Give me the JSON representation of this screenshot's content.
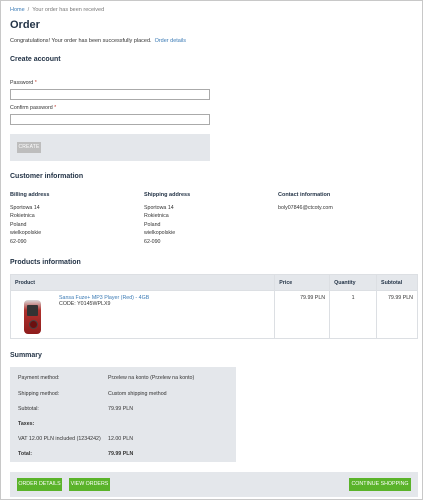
{
  "breadcrumb": {
    "home": "Home",
    "separator": "/",
    "current": "Your order has been received"
  },
  "page_title": "Order",
  "congrats": {
    "text": "Congratulations! Your order has been successfully placed.",
    "link": "Order details"
  },
  "create_account": {
    "title": "Create account",
    "password_label": "Password",
    "confirm_label": "Confirm password",
    "required_mark": "*",
    "create_button": "CREATE"
  },
  "customer_info": {
    "title": "Customer information",
    "billing": {
      "title": "Billing address",
      "lines": [
        "Sportowa 14",
        "Rokietnica",
        "Poland",
        "wielkopolskie",
        "62-090"
      ]
    },
    "shipping": {
      "title": "Shipping address",
      "lines": [
        "Sportowa 14",
        "Rokietnica",
        "Poland",
        "wielkopolskie",
        "62-090"
      ]
    },
    "contact": {
      "title": "Contact information",
      "email": "boly07846@ctcoty.com"
    }
  },
  "products": {
    "title": "Products information",
    "headers": {
      "product": "Product",
      "price": "Price",
      "quantity": "Quantity",
      "subtotal": "Subtotal"
    },
    "rows": [
      {
        "name": "Sansa Fuze+ MP3 Player (Red) - 4GB",
        "code": "CODE: Y0145WPLX9",
        "price": "79.99 PLN",
        "quantity": "1",
        "subtotal": "79.99 PLN"
      }
    ]
  },
  "summary": {
    "title": "Summary",
    "payment_label": "Payment method:",
    "payment_value": "Przelew na konto (Przelew na konto)",
    "shipping_label": "Shipping method:",
    "shipping_value": "Custom shipping method",
    "subtotal_label": "Subtotal:",
    "subtotal_value": "79.99 PLN",
    "taxes_label": "Taxes:",
    "vat_label": "VAT 12.00 PLN included (1234242)",
    "vat_value": "12.00 PLN",
    "total_label": "Total:",
    "total_value": "79.99 PLN"
  },
  "actions": {
    "order_details": "ORDER DETAILS",
    "view_orders": "VIEW ORDERS",
    "continue": "CONTINUE SHOPPING"
  },
  "colors": {
    "accent_green": "#5ab32a",
    "link_blue": "#3a7ab5",
    "panel_gray": "#e4e7eb",
    "heading": "#243447"
  }
}
